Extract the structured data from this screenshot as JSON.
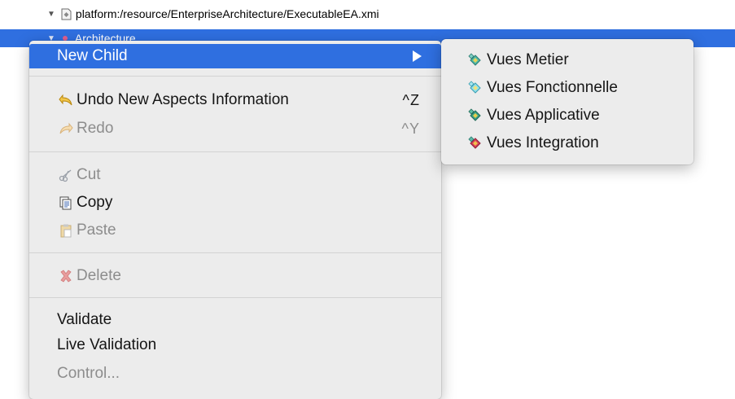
{
  "tree": {
    "root_label": "platform:/resource/EnterpriseArchitecture/ExecutableEA.xmi",
    "selected_label": "Architecture"
  },
  "context_menu": {
    "new_child": "New Child",
    "undo": {
      "label": "Undo New Aspects Information",
      "shortcut": "^Z"
    },
    "redo": {
      "label": "Redo",
      "shortcut": "^Y"
    },
    "cut": "Cut",
    "copy": "Copy",
    "paste": "Paste",
    "delete": "Delete",
    "validate": "Validate",
    "live_validation": "Live Validation",
    "control": "Control..."
  },
  "submenu": {
    "items": [
      {
        "label": "Vues Metier",
        "icon": "vues-metier-icon",
        "accent": "#3aa39a"
      },
      {
        "label": "Vues Fonctionnelle",
        "icon": "vues-fonctionnelle-icon",
        "accent": "#6dcfe0"
      },
      {
        "label": "Vues Applicative",
        "icon": "vues-applicative-icon",
        "accent": "#2a8f7a"
      },
      {
        "label": "Vues Integration",
        "icon": "vues-integration-icon",
        "accent": "#d03050"
      }
    ]
  },
  "colors": {
    "selection": "#2f6fe0",
    "menu_background": "#ececec",
    "disabled_text": "#8d8d8d"
  }
}
